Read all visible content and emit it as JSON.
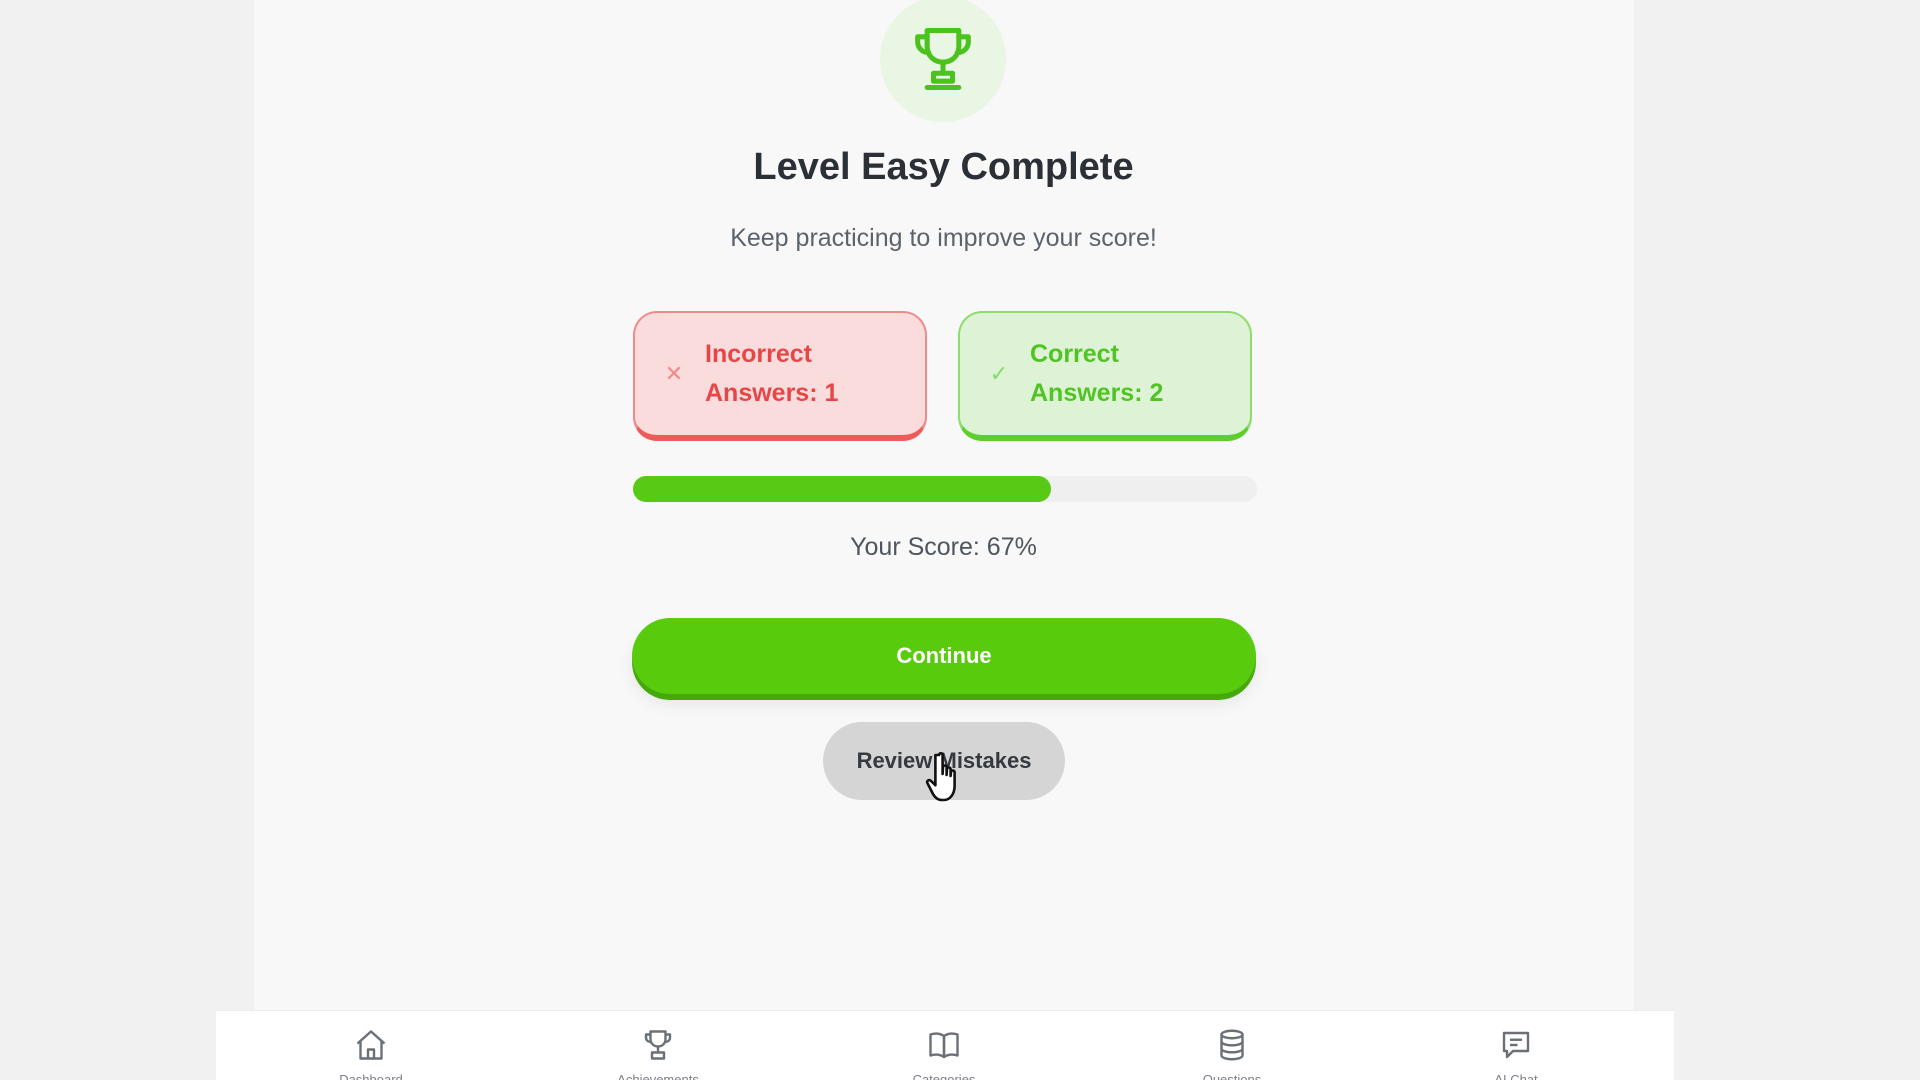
{
  "result": {
    "title": "Level Easy Complete",
    "subtitle": "Keep practicing to improve your score!",
    "incorrect_label": "Incorrect Answers: 1",
    "correct_label": "Correct Answers: 2",
    "score_text": "Your Score: 67%",
    "progress_fraction": 0.67
  },
  "actions": {
    "continue_label": "Continue",
    "review_label": "Review Mistakes"
  },
  "nav": {
    "items": [
      {
        "icon": "home-icon",
        "label": "Dashboard"
      },
      {
        "icon": "trophy-icon",
        "label": "Achievements"
      },
      {
        "icon": "book-icon",
        "label": "Categories"
      },
      {
        "icon": "database-icon",
        "label": "Questions"
      },
      {
        "icon": "chat-icon",
        "label": "AI Chat"
      }
    ]
  },
  "colors": {
    "accent_green": "#58cc0c",
    "error_red": "#e64646",
    "success_green": "#4fc423"
  }
}
